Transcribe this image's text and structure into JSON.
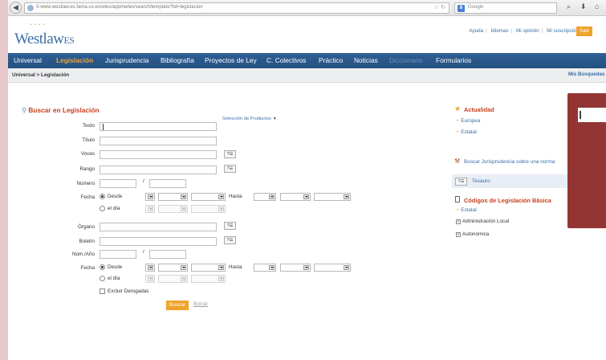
{
  "browser": {
    "url": "0-www.westlaw.es.fama.us.es/wles/app/nwles/search/template?tid=legislacion",
    "search_engine": "Google",
    "back_icon": "back-arrow-icon",
    "globe_icon": "globe-icon",
    "bookmark_icon": "star-icon",
    "reload_icon": "reload-icon",
    "search_icon": "magnifier-icon",
    "download_icon": "download-icon",
    "home_icon": "home-icon"
  },
  "header": {
    "logo_main": "Westlaw",
    "logo_suffix": "ES",
    "links": [
      "Ayuda",
      "Idiomas",
      "Mi opinión",
      "Mi suscripción"
    ],
    "logout": "Salir"
  },
  "nav": {
    "items": [
      "Universal",
      "Legislación",
      "Jurisprudencia",
      "Bibliografía",
      "Proyectos de Ley",
      "C. Colectivos",
      "Práctico",
      "Noticias",
      "Diccionario",
      "Formularios"
    ],
    "active": "Legislación",
    "disabled": "Diccionario"
  },
  "breadcrumb": "Universal > Legislación",
  "saved_searches": "Mis Búsquedas",
  "search_form": {
    "title": "Buscar en Legislación",
    "product_selector": "Selección de Productos",
    "labels": {
      "texto": "Texto",
      "titulo": "Título",
      "voces": "Voces",
      "rango": "Rango",
      "numero": "Número",
      "fecha": "Fecha",
      "organo": "Órgano",
      "boletin": "Boletín",
      "num_ano": "Núm./Año",
      "fecha2": "Fecha"
    },
    "desde": "Desde",
    "el_dia": "el día",
    "hasta": "Hasta",
    "slash": "/",
    "thesaurus_btn": "?☰",
    "excluir": "Excluir Derogadas",
    "buscar": "Buscar",
    "borrar": "Borrar"
  },
  "sidebar": {
    "actualidad_title": "Actualidad",
    "actualidad_links": [
      "Europea",
      "Estatal"
    ],
    "buscar_juris": "Buscar Jurisprudencia sobre una norma",
    "tesauro_btn": "?☰",
    "tesauro": "Tesauro",
    "codigos_title": "Códigos de Legislación Básica",
    "codigos_link": "Estatal",
    "tree": [
      "Administración Local",
      "Autonómica"
    ],
    "tree_marker": "+"
  },
  "colors": {
    "nav_bg": "#2f5f96",
    "accent_orange": "#f0a22a",
    "title_red": "#c8401c",
    "link_blue": "#3a6ea5",
    "overlay_red": "#933533"
  }
}
